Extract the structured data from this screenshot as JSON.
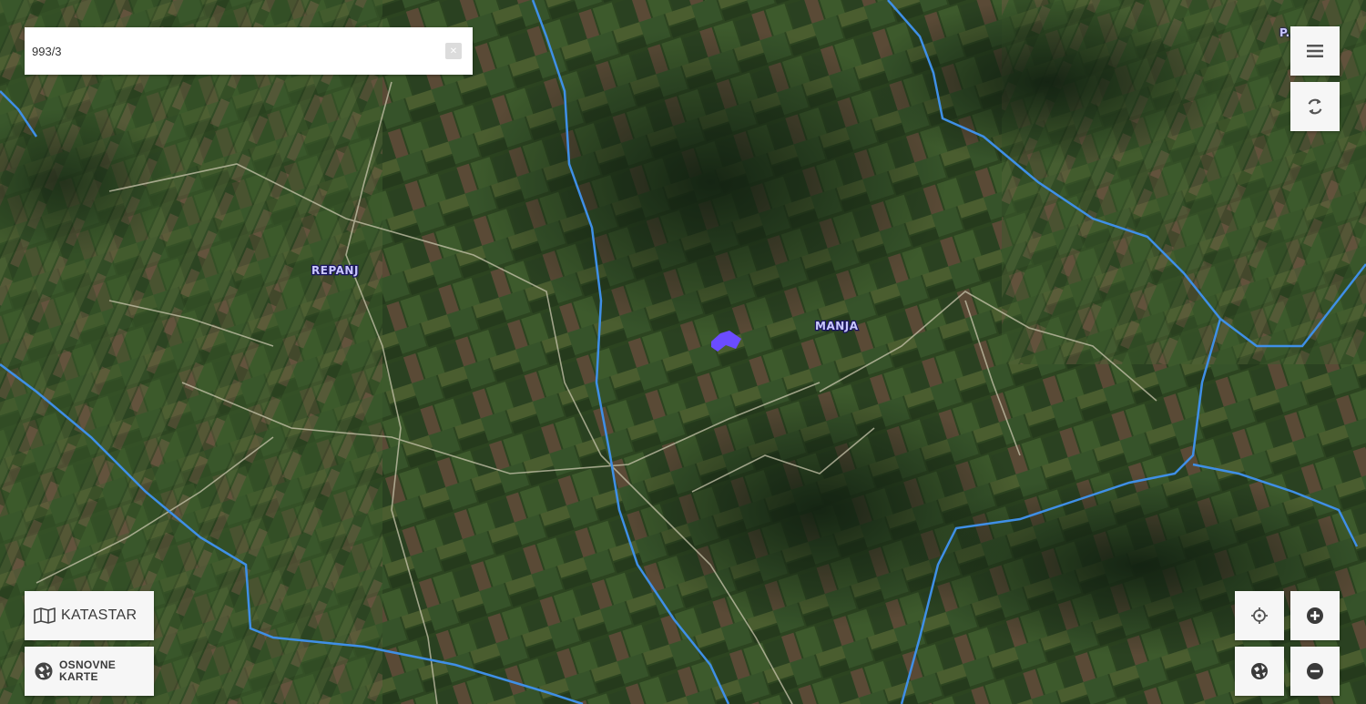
{
  "search": {
    "value": "993/3",
    "clear_icon": "close-icon"
  },
  "map": {
    "base_layer": "satellite imagery",
    "labels": [
      {
        "text": "REPANJ",
        "name": "place-label-rapanja"
      },
      {
        "text": "MANJA",
        "name": "place-label-manja"
      }
    ],
    "top_right_label": "P...",
    "parcel_highlight_color": "#6b4cff",
    "boundary_color": "#3f8fe6"
  },
  "controls": {
    "menu_icon": "menu-icon",
    "refresh_icon": "refresh-icon",
    "locate_icon": "crosshair-icon",
    "globe_icon": "globe-icon",
    "zoom_in_icon": "plus-icon",
    "zoom_out_icon": "minus-icon"
  },
  "layers": {
    "katastar_label": "KATASTAR",
    "katastar_icon": "map-icon",
    "osnovne_label_line1": "OSNOVNE",
    "osnovne_label_line2": "KARTE",
    "osnovne_icon": "basemap-icon"
  }
}
